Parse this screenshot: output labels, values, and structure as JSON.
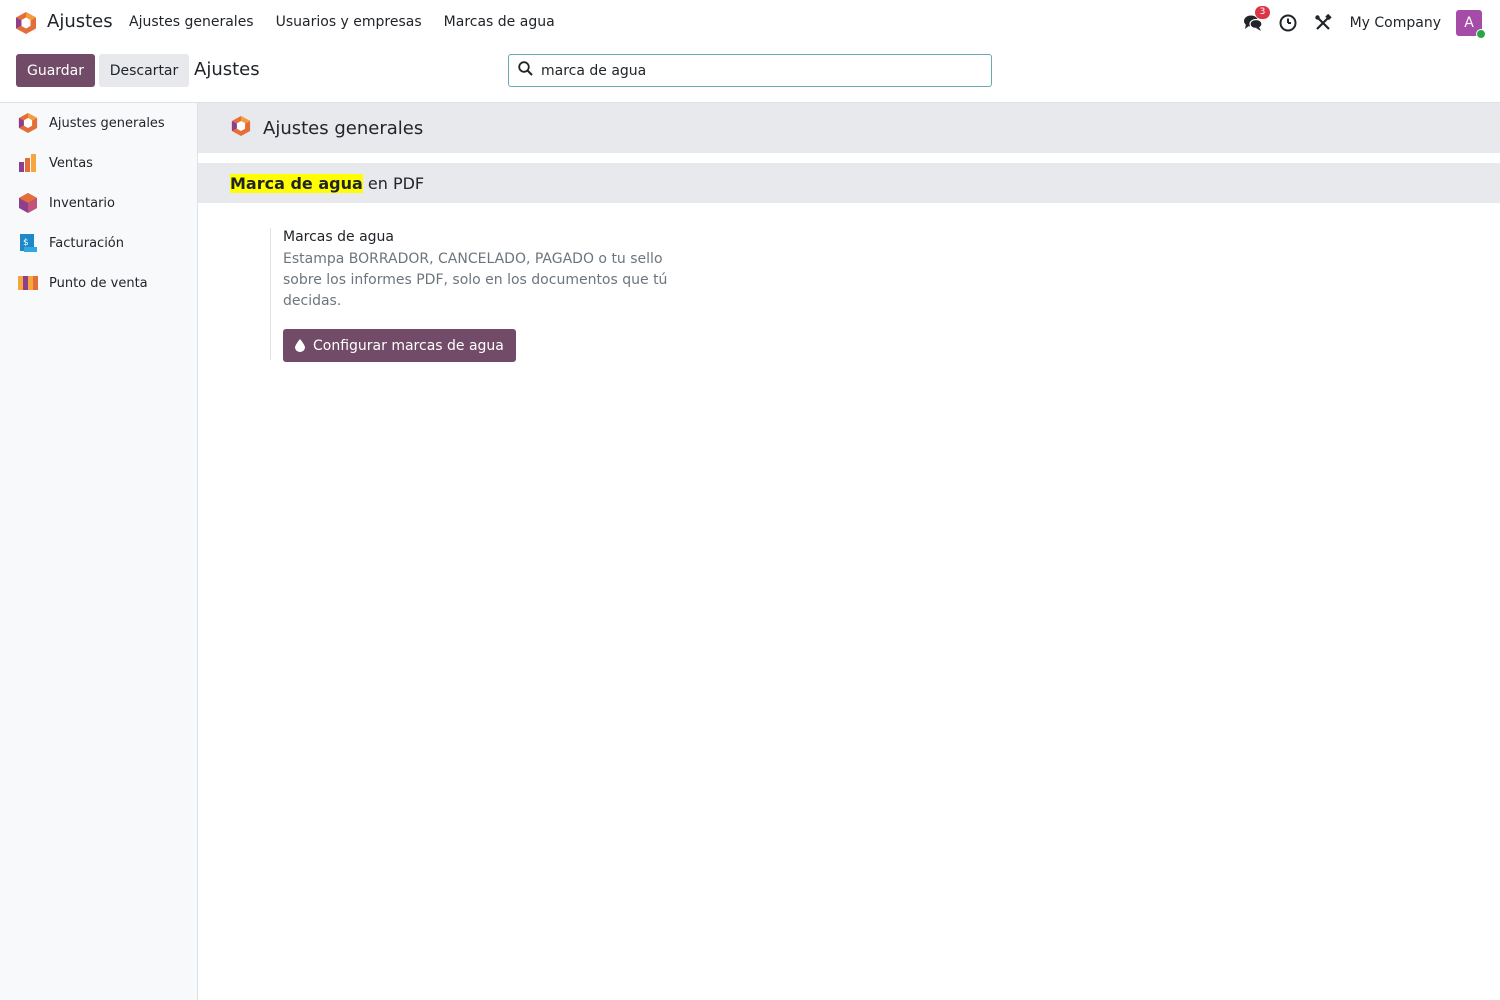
{
  "navbar": {
    "app_name": "Ajustes",
    "menu": [
      "Ajustes generales",
      "Usuarios y empresas",
      "Marcas de agua"
    ],
    "messages_badge": "3",
    "company": "My Company",
    "avatar_letter": "A"
  },
  "control_panel": {
    "save_label": "Guardar",
    "discard_label": "Descartar",
    "title": "Ajustes",
    "search_value": "marca de agua"
  },
  "sidebar": {
    "items": [
      {
        "label": "Ajustes generales",
        "icon": "settings-app-icon"
      },
      {
        "label": "Ventas",
        "icon": "sales-app-icon"
      },
      {
        "label": "Inventario",
        "icon": "inventory-app-icon"
      },
      {
        "label": "Facturación",
        "icon": "invoicing-app-icon"
      },
      {
        "label": "Punto de venta",
        "icon": "pos-app-icon"
      }
    ]
  },
  "main": {
    "app_header": "Ajustes generales",
    "section": {
      "highlight": "Marca de agua",
      "rest": " en PDF"
    },
    "setting": {
      "label": "Marcas de agua",
      "description": "Estampa BORRADOR, CANCELADO, PAGADO o tu sello sobre los informes PDF, solo en los documentos que tú decidas.",
      "button_label": "Configurar marcas de agua"
    }
  },
  "colors": {
    "primary": "#714b67",
    "highlight": "#ffff00",
    "badge": "#dc3545"
  }
}
